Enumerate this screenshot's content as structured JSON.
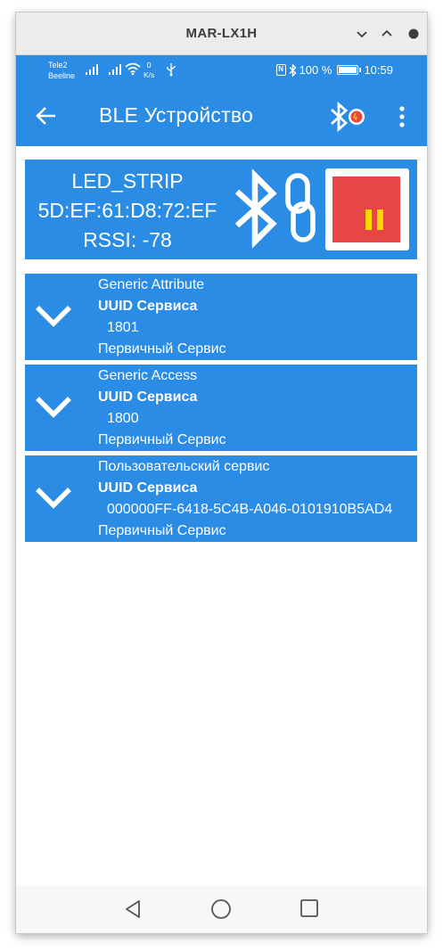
{
  "window": {
    "title": "MAR-LX1H"
  },
  "status": {
    "carrier1": "Tele2",
    "carrier2": "Beeline",
    "net_speed_value": "0",
    "net_speed_unit": "K/s",
    "battery": "100 %",
    "time": "10:59"
  },
  "appbar": {
    "title": "BLE Устройство"
  },
  "device": {
    "name": "LED_STRIP",
    "mac": "5D:EF:61:D8:72:EF",
    "rssi": "RSSI: -78"
  },
  "services": [
    {
      "name": "Generic Attribute",
      "uuid_label": "UUID Сервиса",
      "uuid": "1801",
      "type": "Первичный Сервис"
    },
    {
      "name": "Generic Access",
      "uuid_label": "UUID Сервиса",
      "uuid": "1800",
      "type": "Первичный Сервис"
    },
    {
      "name": "Пользовательский сервис",
      "uuid_label": "UUID Сервиса",
      "uuid": "000000FF-6418-5C4B-A046-0101910B5AD4",
      "type": "Первичный Сервис"
    }
  ],
  "colors": {
    "primary": "#2b8ce6",
    "stop_button": "#e84545",
    "pause_bars": "#ffd700"
  },
  "icons": {
    "window": [
      "chevron-down-icon",
      "chevron-up-icon",
      "close-icon"
    ],
    "appbar": [
      "back-arrow-icon",
      "bluetooth-scan-icon",
      "overflow-menu-icon"
    ],
    "device": [
      "bluetooth-icon",
      "link-icon",
      "pause-icon"
    ],
    "nav": [
      "nav-back-icon",
      "nav-home-icon",
      "nav-recents-icon"
    ]
  }
}
